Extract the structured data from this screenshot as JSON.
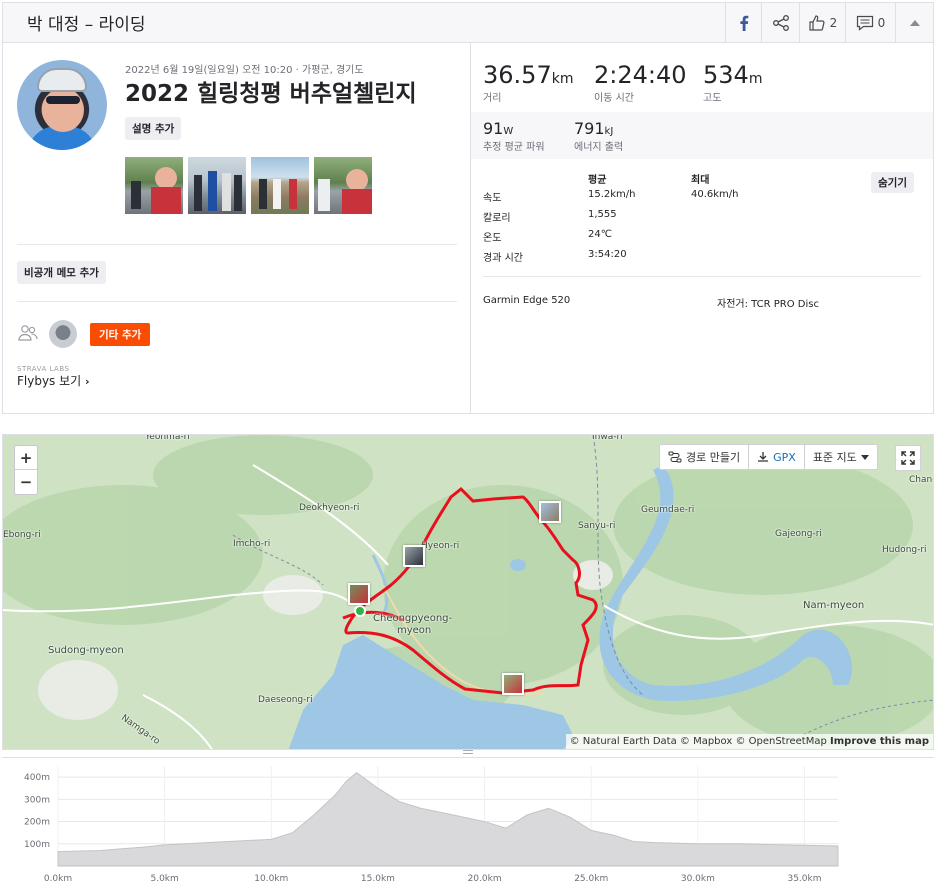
{
  "header": {
    "title": "박 대정 – 라이딩",
    "kudos_count": "2",
    "comments_count": "0",
    "icons": [
      "facebook-icon",
      "share-icon",
      "kudos-icon",
      "comment-icon",
      "chevron-up-icon"
    ]
  },
  "activity": {
    "date": "2022년 6월 19일(일요일) 오전 10:20 · 가평군, 경기도",
    "title": "2022 힐링청평 버추얼첼린지",
    "add_description": "설명 추가",
    "private_note": "비공개 메모 추가",
    "add_others": "기타 추가",
    "labs": "STRAVA LABS",
    "flybys": "Flybys 보기"
  },
  "stats": {
    "distance": {
      "value": "36.57",
      "unit": "km",
      "label": "거리"
    },
    "moving_time": {
      "value": "2:24:40",
      "label": "이동 시간"
    },
    "elevation": {
      "value": "534",
      "unit": "m",
      "label": "고도"
    },
    "power": {
      "value": "91",
      "unit": "W",
      "label": "추정 평균 파워"
    },
    "energy": {
      "value": "791",
      "unit": "kJ",
      "label": "에너지 출력"
    }
  },
  "details": {
    "col_avg": "평균",
    "col_max": "최대",
    "hide": "숨기기",
    "rows": [
      {
        "label": "속도",
        "avg": "15.2km/h",
        "max": "40.6km/h"
      },
      {
        "label": "칼로리",
        "avg": "1,555",
        "max": ""
      },
      {
        "label": "온도",
        "avg": "24℃",
        "max": ""
      },
      {
        "label": "경과 시간",
        "avg": "3:54:20",
        "max": ""
      }
    ],
    "device": "Garmin Edge 520",
    "bike": "자전거: TCR PRO Disc"
  },
  "map": {
    "zoom_in": "+",
    "zoom_out": "−",
    "route_builder": "경로 만들기",
    "gpx": "GPX",
    "map_type": "표준 지도",
    "attribution_a": "© Natural Earth Data © Mapbox © OpenStreetMap",
    "attribution_b": "Improve this map",
    "labels": [
      "Yeohma-ri",
      "Ihwa-ri",
      "Deokhyeon-ri",
      "Ebong-ri",
      "Imcho-ri",
      "Hyeon-ri",
      "Sanyu-ri",
      "Geumdae-ri",
      "Gajeong-ri",
      "Hudong-ri",
      "Changc",
      "Cheongpyeong-",
      "myeon",
      "Nam-myeon",
      "Sudong-myeon",
      "Daeseong-ri",
      "Namga-ro"
    ],
    "route_color": "#e8101c"
  },
  "elevation_chart": {
    "type": "area",
    "y_ticks": [
      "400m",
      "300m",
      "200m",
      "100m"
    ],
    "x_ticks": [
      "0.0km",
      "5.0km",
      "10.0km",
      "15.0km",
      "20.0km",
      "25.0km",
      "30.0km",
      "35.0km"
    ],
    "x_km": [
      0,
      2,
      4,
      5,
      6,
      8,
      10,
      11,
      12,
      13,
      13.5,
      14,
      15,
      16,
      17,
      18,
      19,
      20,
      21,
      22,
      23,
      24,
      25,
      26,
      27,
      28,
      30,
      32,
      34,
      36.57
    ],
    "y_m": [
      65,
      70,
      85,
      95,
      100,
      110,
      120,
      150,
      230,
      320,
      380,
      420,
      350,
      290,
      260,
      240,
      220,
      200,
      170,
      230,
      260,
      220,
      160,
      140,
      110,
      105,
      100,
      100,
      95,
      90
    ],
    "ylim": [
      0,
      450
    ],
    "xlim": [
      0,
      36.57
    ]
  }
}
